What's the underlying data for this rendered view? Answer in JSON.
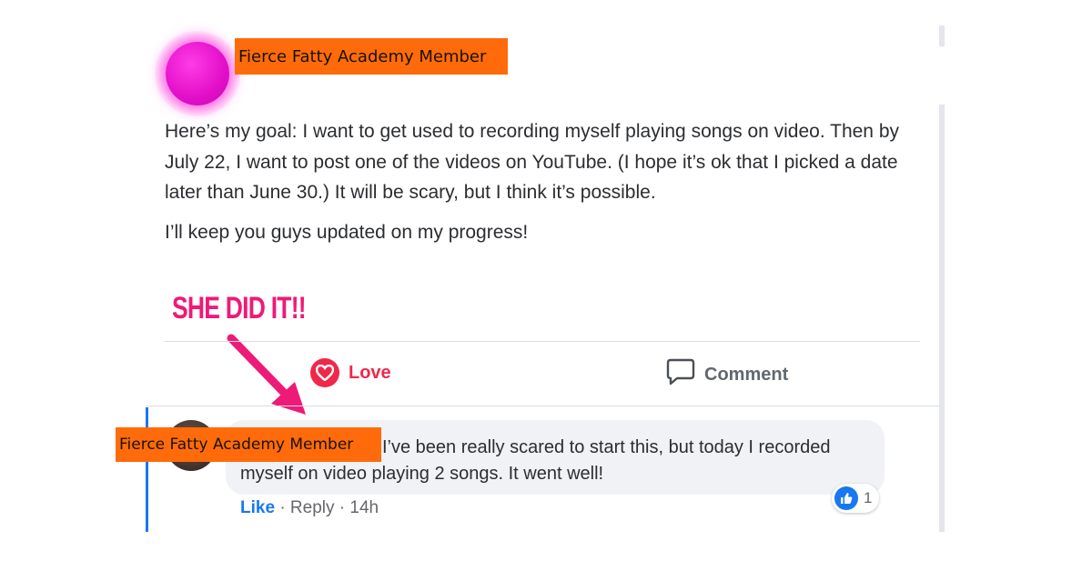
{
  "post": {
    "author_label": "Fierce Fatty Academy Member",
    "paragraphs": [
      "Here’s my goal: I want to get used to recording myself playing songs on video. Then by July 22, I want to post one of the videos on YouTube. (I hope it’s ok that I picked a date later than June 30.) It will be scary, but I think it’s possible.",
      "I’ll keep you guys updated on my progress!"
    ]
  },
  "annotation": {
    "text": "SHE DID IT!!",
    "color": "#ee1a78"
  },
  "actions": {
    "love_label": "Love",
    "comment_label": "Comment",
    "love_icon": "heart-icon",
    "comment_icon": "speech-bubble-icon"
  },
  "comment": {
    "author_label": "Fierce Fatty Academy Member",
    "text": "I’ve been really scared to start this, but today I recorded myself on video playing 2 songs. It went well!",
    "like_label": "Like",
    "separator": "·",
    "reply_label": "Reply",
    "timestamp": "14h",
    "reaction_count": "1",
    "reaction_icon": "thumbs-up-icon"
  },
  "colors": {
    "label_bg": "#ff6b0a",
    "love": "#f0284a",
    "facebook_blue": "#1877f2"
  }
}
